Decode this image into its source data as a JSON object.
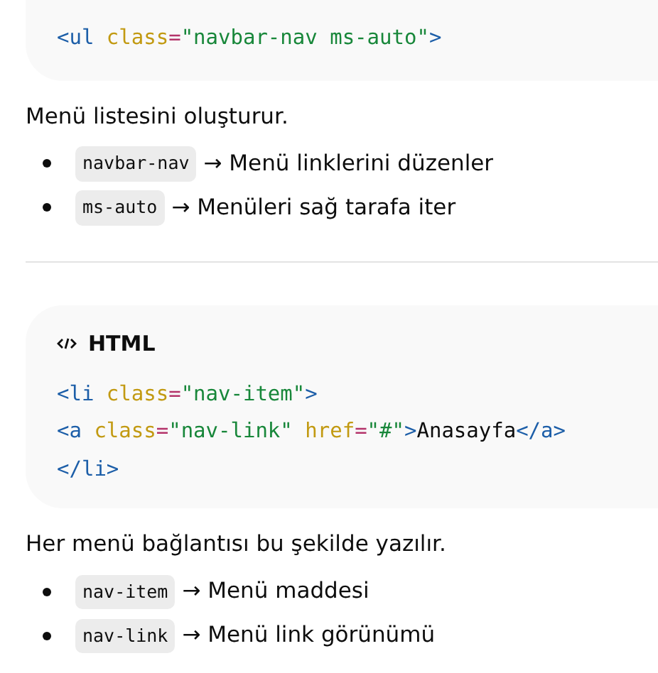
{
  "blocks": [
    {
      "kind": "code",
      "lines": [
        [
          {
            "kind": "tag",
            "text": "<ul"
          },
          {
            "kind": "attr",
            "text": " class"
          },
          {
            "kind": "punct",
            "text": "="
          },
          {
            "kind": "str",
            "text": "\"navbar-nav ms-auto\""
          },
          {
            "kind": "tag",
            "text": ">"
          }
        ]
      ]
    },
    {
      "kind": "para",
      "text": "Menü listesini oluşturur."
    },
    {
      "kind": "bullets",
      "items": [
        {
          "code": "navbar-nav",
          "text": "→ Menü linklerini düzenler"
        },
        {
          "code": "ms-auto",
          "text": "→ Menüleri sağ tarafa iter"
        }
      ]
    },
    {
      "kind": "divider"
    },
    {
      "kind": "code",
      "language": "HTML",
      "lines": [
        [
          {
            "kind": "tag",
            "text": "<li"
          },
          {
            "kind": "attr",
            "text": " class"
          },
          {
            "kind": "punct",
            "text": "="
          },
          {
            "kind": "str",
            "text": "\"nav-item\""
          },
          {
            "kind": "tag",
            "text": ">"
          }
        ],
        [
          {
            "kind": "tag",
            "text": "<a"
          },
          {
            "kind": "attr",
            "text": " class"
          },
          {
            "kind": "punct",
            "text": "="
          },
          {
            "kind": "str",
            "text": "\"nav-link\""
          },
          {
            "kind": "attr",
            "text": " href"
          },
          {
            "kind": "punct",
            "text": "="
          },
          {
            "kind": "str",
            "text": "\"#\""
          },
          {
            "kind": "tag",
            "text": ">"
          },
          {
            "kind": "plain",
            "text": "Anasayfa"
          },
          {
            "kind": "tag",
            "text": "</a>"
          }
        ],
        [
          {
            "kind": "tag",
            "text": "</li>"
          }
        ]
      ]
    },
    {
      "kind": "para",
      "text": "Her menü bağlantısı bu şekilde yazılır."
    },
    {
      "kind": "bullets",
      "items": [
        {
          "code": "nav-item",
          "text": "→ Menü maddesi"
        },
        {
          "code": "nav-link",
          "text": "→ Menü link görünümü"
        }
      ]
    }
  ]
}
